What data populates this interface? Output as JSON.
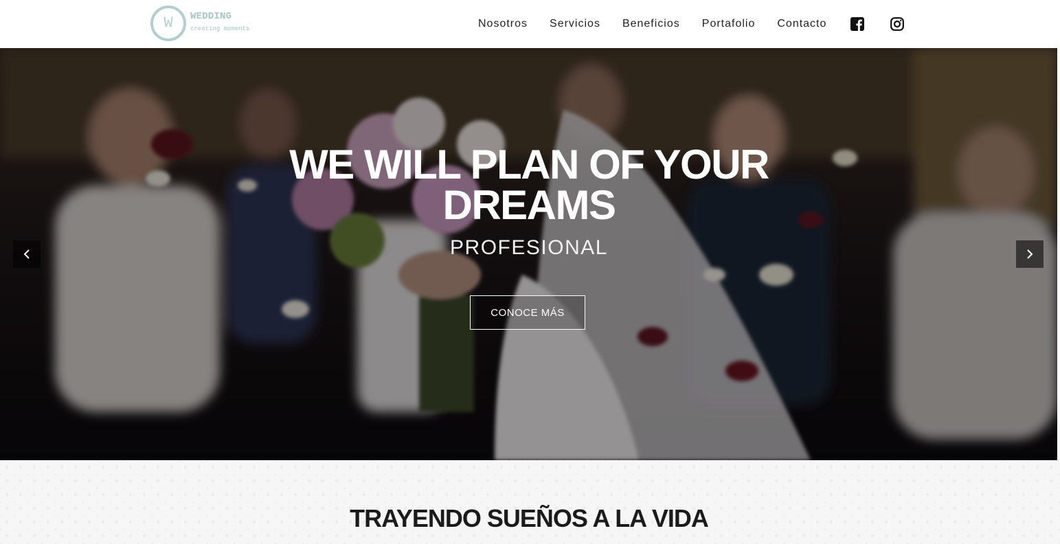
{
  "logo": {
    "letter": "W",
    "name": "WEDDING",
    "tagline": "creating moments"
  },
  "nav": {
    "items": [
      {
        "label": "Nosotros"
      },
      {
        "label": "Servicios"
      },
      {
        "label": "Beneficios"
      },
      {
        "label": "Portafolio"
      },
      {
        "label": "Contacto"
      }
    ],
    "social": [
      {
        "icon": "facebook-icon"
      },
      {
        "icon": "instagram-icon"
      }
    ]
  },
  "hero": {
    "title": "WE WILL PLAN OF YOUR DREAMS",
    "subtitle": "PROFESIONAL",
    "button_label": "CONOCE MÁS",
    "prev_icon": "chevron-left-icon",
    "next_icon": "chevron-right-icon"
  },
  "section": {
    "title": "TRAYENDO SUEÑOS A LA VIDA"
  },
  "colors": {
    "logo": "#b3cfcd",
    "nav_text": "#222222",
    "hero_overlay": "#000000",
    "section_bg": "#f7f6f6"
  }
}
